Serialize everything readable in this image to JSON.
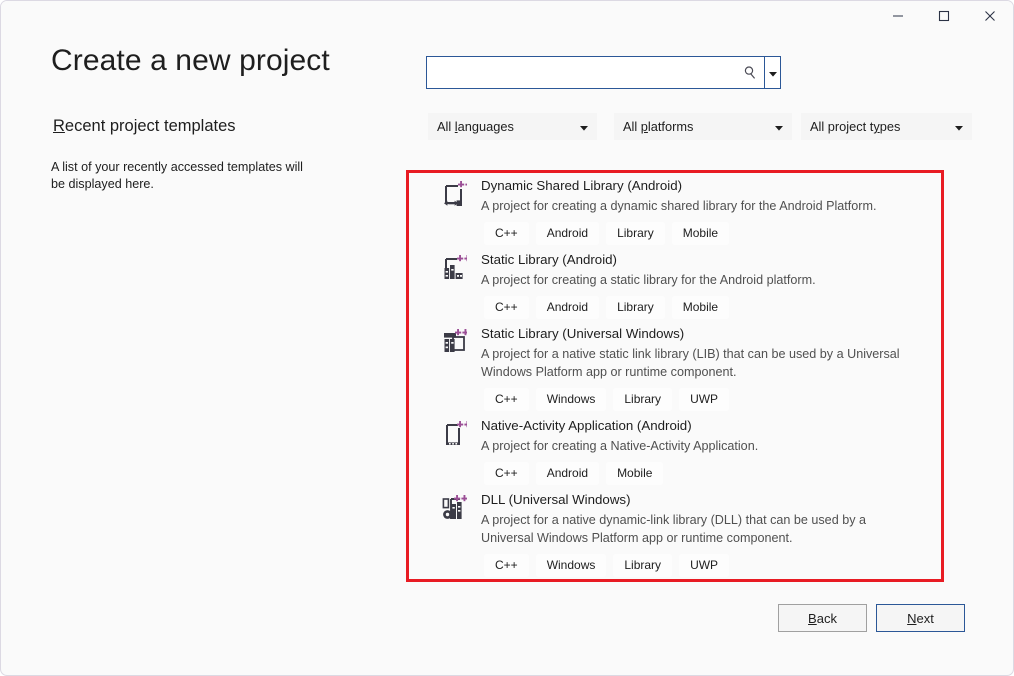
{
  "window": {
    "controls": [
      {
        "name": "minimize",
        "glyph": "minimize-icon"
      },
      {
        "name": "maximize",
        "glyph": "maximize-icon"
      },
      {
        "name": "close",
        "glyph": "close-icon"
      }
    ]
  },
  "header": {
    "title": "Create a new project"
  },
  "recent": {
    "heading_mnemonic": "R",
    "heading_rest": "ecent project templates",
    "empty_text": "A list of your recently accessed templates will be displayed here."
  },
  "search": {
    "value": "",
    "placeholder": "",
    "icon": "search-icon",
    "dropdown_icon": "chevron-down-icon"
  },
  "filters": [
    {
      "key": "languages",
      "pre": "All ",
      "mnemonic": "l",
      "post": "anguages"
    },
    {
      "key": "platforms",
      "pre": "All ",
      "mnemonic": "p",
      "post": "latforms"
    },
    {
      "key": "types",
      "pre": "All project t",
      "mnemonic": "y",
      "post": "pes"
    }
  ],
  "templates": [
    {
      "icon": "dynamic-shared-library-android-icon",
      "title": "Dynamic Shared Library (Android)",
      "description": "A project for creating a dynamic shared library for the Android Platform.",
      "tags": [
        "C++",
        "Android",
        "Library",
        "Mobile"
      ]
    },
    {
      "icon": "static-library-android-icon",
      "title": "Static Library (Android)",
      "description": "A project for creating a static library for the Android platform.",
      "tags": [
        "C++",
        "Android",
        "Library",
        "Mobile"
      ]
    },
    {
      "icon": "static-library-uwp-icon",
      "title": "Static Library (Universal Windows)",
      "description": "A project for a native static link library (LIB) that can be used by a Universal Windows Platform app or runtime component.",
      "tags": [
        "C++",
        "Windows",
        "Library",
        "UWP"
      ]
    },
    {
      "icon": "native-activity-application-android-icon",
      "title": "Native-Activity Application (Android)",
      "description": "A project for creating a Native-Activity Application.",
      "tags": [
        "C++",
        "Android",
        "Mobile"
      ]
    },
    {
      "icon": "dll-uwp-icon",
      "title": "DLL (Universal Windows)",
      "description": "A project for a native dynamic-link library (DLL) that can be used by a Universal Windows Platform app or runtime component.",
      "tags": [
        "C++",
        "Windows",
        "Library",
        "UWP"
      ]
    }
  ],
  "footer": {
    "back": {
      "mnemonic": "B",
      "rest": "ack"
    },
    "next": {
      "mnemonic": "N",
      "rest": "ext"
    }
  },
  "colors": {
    "accent_blue": "#2b5797",
    "annotation_red": "#e81b23",
    "cpp_purple": "#9b4f96",
    "page_bg": "#fafafa",
    "control_bg": "#f5f5f5"
  }
}
